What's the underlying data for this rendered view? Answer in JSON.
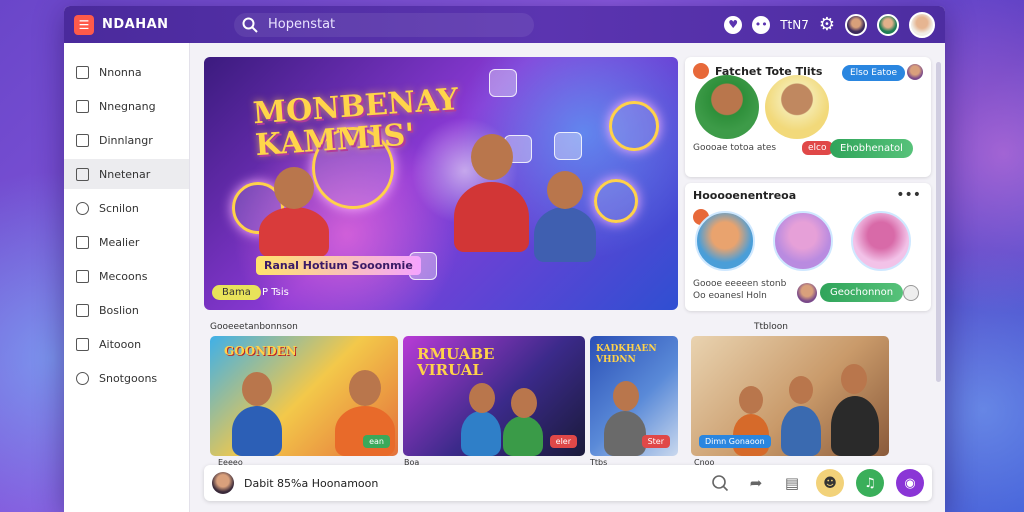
{
  "header": {
    "logo_glyph": "☰",
    "app_title": "NDAHAN",
    "search_placeholder": "Hopenstat",
    "heart_glyph": "♥",
    "chat_glyph": "••",
    "status_label": "TtN7"
  },
  "sidebar": {
    "items": [
      {
        "label": "Nnonna"
      },
      {
        "label": "Nnegnang"
      },
      {
        "label": "Dinnlangr"
      },
      {
        "label": "Nnetenar"
      },
      {
        "label": "Scnilon"
      },
      {
        "label": "Mealier"
      },
      {
        "label": "Mecoons"
      },
      {
        "label": "Boslion"
      },
      {
        "label": "Aitooon"
      },
      {
        "label": "Snotgoons"
      }
    ]
  },
  "hero": {
    "title": "MONBENAY\nKAMMIS'",
    "caption": "Ranal Hotium Sooonmie",
    "pill": "Bama",
    "meta": "P Tsis"
  },
  "card1": {
    "title": "Fatchet Tote Tlits",
    "pill": "Elso Eatoe",
    "subtitle": "Goooae totoa ates",
    "red_pill": "elco",
    "green_pill": "Ehobhenatol"
  },
  "card2": {
    "title": "Hooooenentreoa",
    "more": "•••",
    "subtitle1": "Goooe eeeeen stonb",
    "subtitle2": "Oo eoanesl Holn",
    "green_pill": "Geochonnon"
  },
  "section": {
    "label": "Gooeeetanbonnson",
    "right_label": "Ttbloon"
  },
  "thumbs": [
    {
      "title": "GOONDEN",
      "tag": "ean",
      "caption": "Eeeeo alet"
    },
    {
      "title": "RMUABE\nVIRUAL",
      "tag": "eler",
      "caption": "Boa tontonll"
    },
    {
      "title": "KADKHAEN\nVHDNN",
      "tag": "Ster",
      "caption": "Ttbs"
    },
    {
      "title": "",
      "tag": "Dimn Gonaoon",
      "caption": "Cnoo eoooeot"
    }
  ],
  "bottombar": {
    "text": "Dabit 85%a Hoonamoon",
    "icons": [
      "search-icon",
      "share-icon",
      "document-icon"
    ]
  },
  "colors": {
    "topbar": "#4a2a9c",
    "accent_green": "#2fa45a",
    "accent_purple": "#8a35d6",
    "accent_red": "#e04848",
    "accent_blue": "#2a86e0"
  }
}
